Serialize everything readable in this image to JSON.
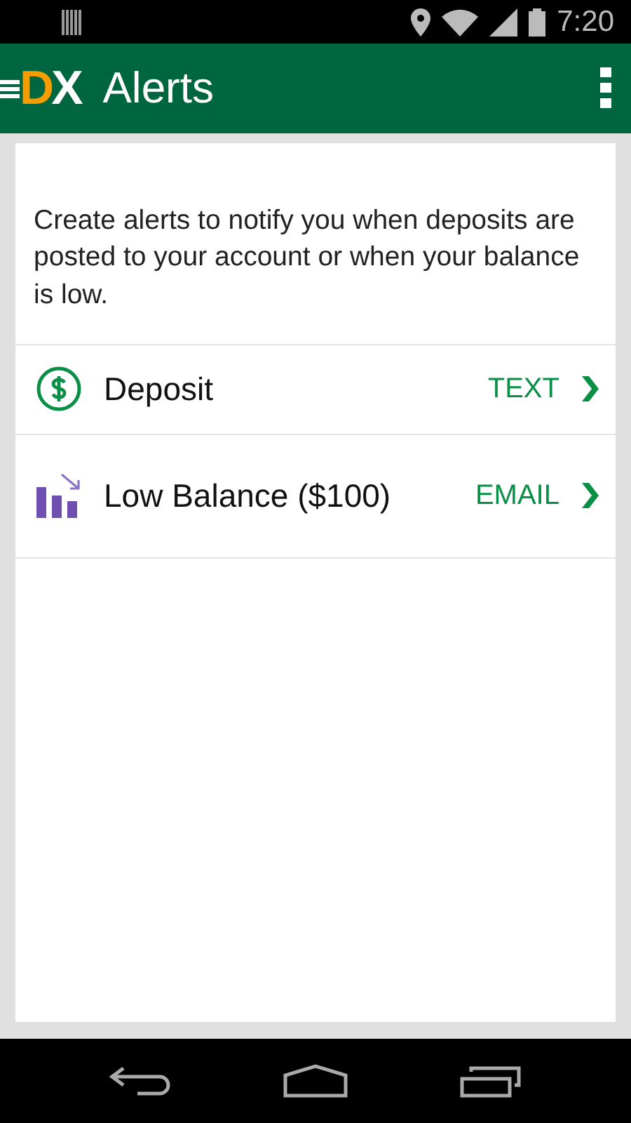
{
  "status_bar": {
    "time": "7:20"
  },
  "app_bar": {
    "logo": "DX",
    "title": "Alerts"
  },
  "intro": "Create alerts to notify you when deposits are posted to your account or when your balance is low.",
  "alerts": [
    {
      "kind": "deposit",
      "name": "Deposit",
      "method": "TEXT"
    },
    {
      "kind": "low-balance",
      "name": "Low Balance ($100)",
      "method": "EMAIL"
    }
  ]
}
